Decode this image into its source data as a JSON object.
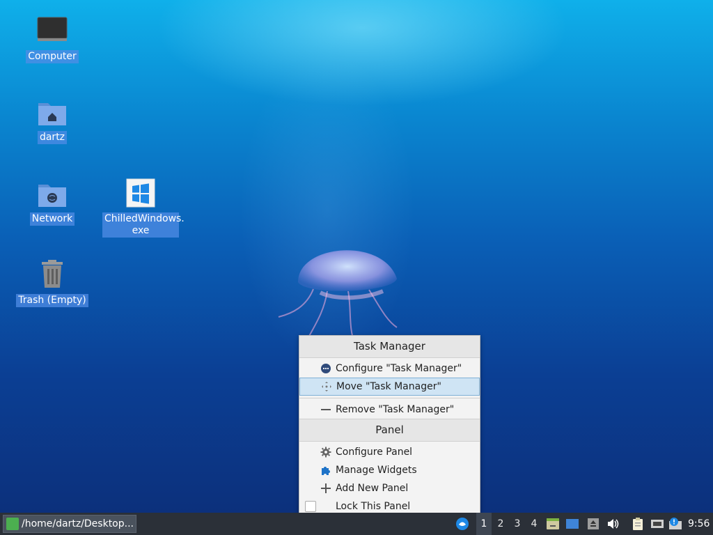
{
  "desktop": {
    "icons": [
      {
        "label": "Computer"
      },
      {
        "label": "dartz"
      },
      {
        "label": "Network"
      },
      {
        "label": "ChilledWindows.\nexe"
      },
      {
        "label": "Trash (Empty)"
      }
    ]
  },
  "context_menu": {
    "header1": "Task Manager",
    "configure_task_manager": "Configure \"Task Manager\"",
    "move_task_manager": "Move \"Task Manager\"",
    "remove_task_manager": "Remove \"Task Manager\"",
    "header2": "Panel",
    "configure_panel": "Configure Panel",
    "manage_widgets": "Manage Widgets",
    "add_new_panel": "Add New Panel",
    "lock_this_panel": "Lock This Panel"
  },
  "taskbar": {
    "task_label": "/home/dartz/Desktop...",
    "workspaces": [
      "1",
      "2",
      "3",
      "4"
    ],
    "active_workspace": "1",
    "clock": "9:56"
  },
  "colors": {
    "menu_highlight": "#cfe4f4",
    "taskbar_bg": "#2b3038",
    "icon_label_bg": "#508ce6"
  },
  "icons": {
    "computer": "monitor-icon",
    "home": "home-folder-icon",
    "network": "network-folder-icon",
    "exe": "windows-logo-icon",
    "trash": "trash-icon",
    "configure_task_manager": "dots-circle-icon",
    "move": "move-arrows-icon",
    "remove": "minus-icon",
    "configure_panel": "gear-icon",
    "manage_widgets": "puzzle-icon",
    "add_panel": "plus-icon"
  }
}
